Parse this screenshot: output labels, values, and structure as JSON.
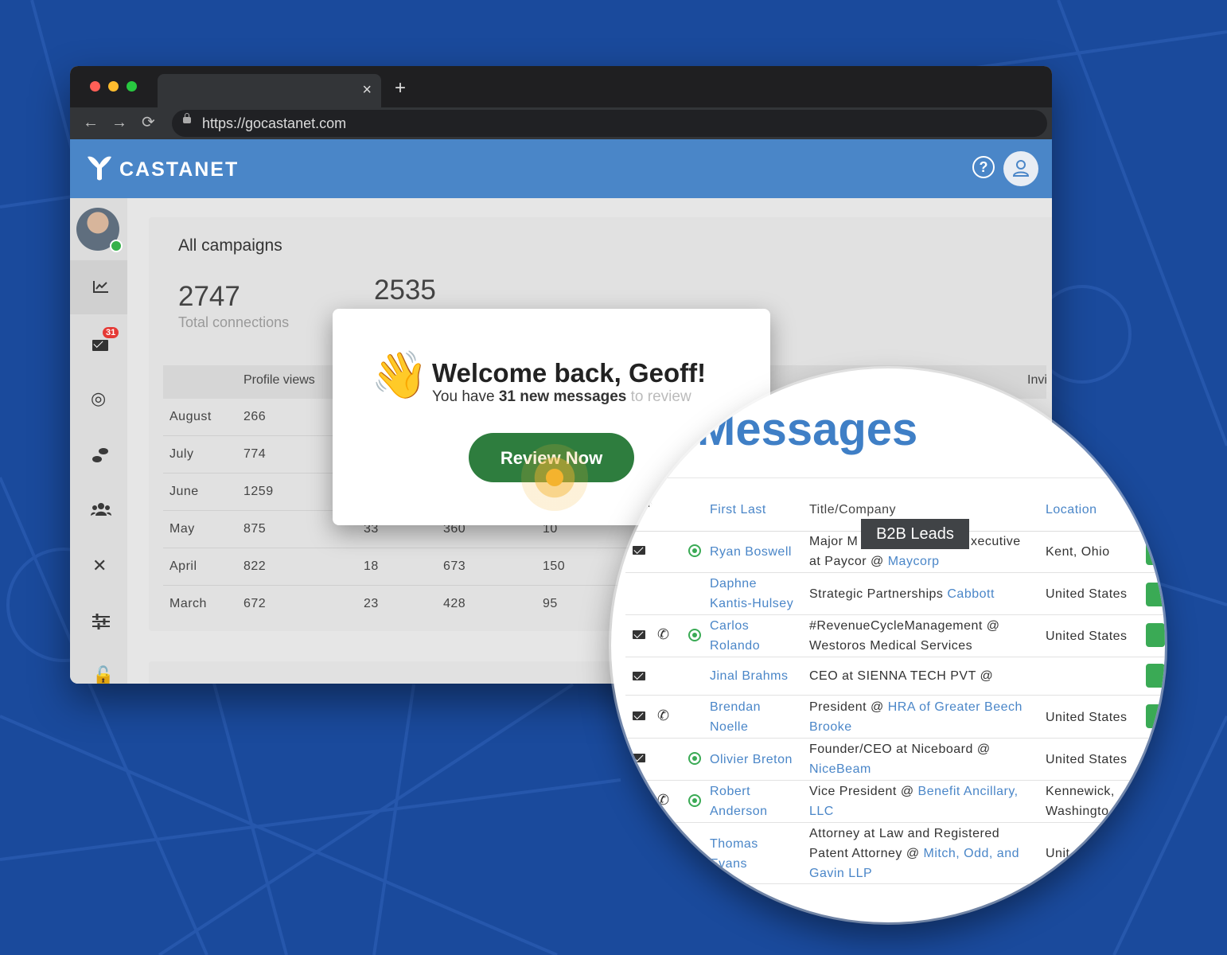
{
  "colors": {
    "background": "#1a4a9c",
    "appbar": "#4a86c8",
    "button": "#2e7d3e",
    "accent_blue": "#4a86c8",
    "badge": "#e53935"
  },
  "browser": {
    "url": "https://gocastanet.com",
    "new_tab_symbol": "+",
    "close_symbol": "×"
  },
  "app": {
    "brand": "CASTANET",
    "help_symbol": "?"
  },
  "sidebar": {
    "badge_count": "31",
    "items": [
      {
        "icon": "chart-icon"
      },
      {
        "icon": "mail-icon"
      },
      {
        "icon": "target-icon"
      },
      {
        "icon": "footsteps-icon"
      },
      {
        "icon": "group-icon"
      },
      {
        "icon": "close-icon"
      },
      {
        "icon": "sliders-icon"
      },
      {
        "icon": "lock-icon"
      }
    ]
  },
  "campaigns": {
    "title": "All campaigns",
    "total_connections": "2747",
    "total_connections_label": "Total connections",
    "second_stat": "2535",
    "columns": [
      "",
      "Profile views",
      "",
      "",
      "",
      "",
      "",
      "",
      "Invi"
    ],
    "rows": [
      {
        "month": "August",
        "views": "266",
        "c3": "",
        "c4": "",
        "c5": ""
      },
      {
        "month": "July",
        "views": "774",
        "c3": "",
        "c4": "",
        "c5": ""
      },
      {
        "month": "June",
        "views": "1259",
        "c3": "",
        "c4": "",
        "c5": ""
      },
      {
        "month": "May",
        "views": "875",
        "c3": "33",
        "c4": "360",
        "c5": "10"
      },
      {
        "month": "April",
        "views": "822",
        "c3": "18",
        "c4": "673",
        "c5": "150"
      },
      {
        "month": "March",
        "views": "672",
        "c3": "23",
        "c4": "428",
        "c5": "95"
      }
    ]
  },
  "modal": {
    "wave": "👋",
    "title": "Welcome back, Geoff!",
    "sub_prefix": "You have ",
    "sub_bold": "31 new messages",
    "sub_suffix": " to review",
    "button": "Review Now"
  },
  "messages": {
    "title": "Messages",
    "headers": {
      "name": "First Last",
      "title": "Title/Company",
      "location": "Location"
    },
    "tooltip": "B2B Leads",
    "rows": [
      {
        "name1": "Ryan Boswell",
        "name2": "",
        "t1": "Major M",
        "t1b": "xecutive",
        "t2": "at Paycor @ ",
        "t2link": "Maycorp",
        "loc1": "Kent, Ohio",
        "loc2": ""
      },
      {
        "name1": "Daphne",
        "name2": "Kantis-Hulsey",
        "t1": "Strategic Partnerships ",
        "t1link": "Cabbott",
        "t2": "",
        "loc1": "United States",
        "loc2": ""
      },
      {
        "name1": "Carlos",
        "name2": "Rolando",
        "t1": "#RevenueCycleManagement @",
        "t2": "Westoros Medical Services",
        "loc1": "United States",
        "loc2": ""
      },
      {
        "name1": "Jinal Brahms",
        "name2": "",
        "t1": "CEO at SIENNA TECH PVT @",
        "t2": "",
        "loc1": "",
        "loc2": ""
      },
      {
        "name1": "Brendan",
        "name2": "Noelle",
        "t1": "President @ ",
        "t1link": "HRA of Greater Beech",
        "t2link": "Brooke",
        "loc1": "United States",
        "loc2": ""
      },
      {
        "name1": "Olivier Breton",
        "name2": "",
        "t1": "Founder/CEO at Niceboard @",
        "t2link": "NiceBeam",
        "loc1": "United States",
        "loc2": ""
      },
      {
        "name1": "Robert",
        "name2": "Anderson",
        "t1": "Vice President @ ",
        "t1link": "Benefit Ancillary,",
        "t2link": "LLC",
        "loc1": "Kennewick,",
        "loc2": "Washingto"
      },
      {
        "name1": "Thomas",
        "name2": "Evans",
        "t1": "Attorney at Law and Registered",
        "t2": "Patent Attorney @ ",
        "t2link": "Mitch, Odd, and",
        "t3link": "Gavin LLP",
        "loc1": "Unit",
        "loc2": ""
      }
    ]
  }
}
